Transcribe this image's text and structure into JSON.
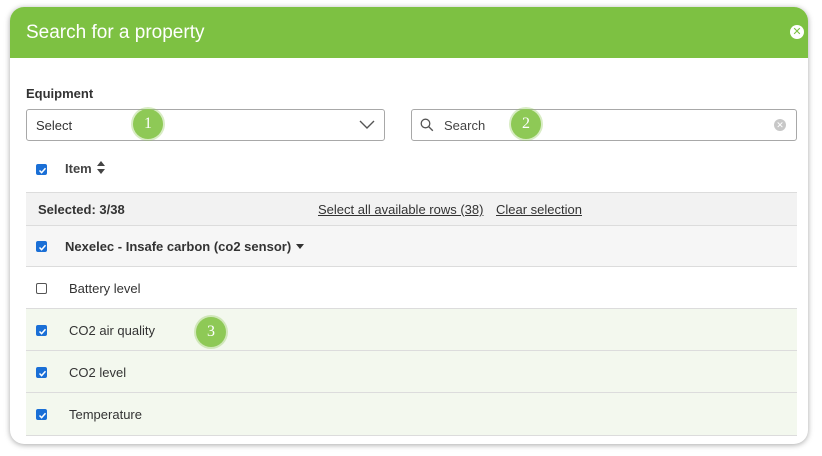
{
  "modal": {
    "title": "Search for a property",
    "close_icon": "close-icon"
  },
  "filters": {
    "equipment_label": "Equipment",
    "equipment_select_value": "Select",
    "search_placeholder": "Search"
  },
  "markers": [
    "1",
    "2",
    "3"
  ],
  "table": {
    "header_item": "Item",
    "selected_text": "Selected: 3/38",
    "select_all_link": "Select all available rows (38)",
    "clear_selection_link": "Clear selection",
    "group": {
      "label": "Nexelec - Insafe carbon (co2 sensor)",
      "checked": true
    },
    "rows": [
      {
        "label": "Battery level",
        "checked": false
      },
      {
        "label": "CO2 air quality",
        "checked": true
      },
      {
        "label": "CO2 level",
        "checked": true
      },
      {
        "label": "Temperature",
        "checked": true
      }
    ]
  },
  "colors": {
    "header_green": "#7dc142",
    "marker_green": "#8ec956",
    "checkbox_blue": "#1a6fd6",
    "selected_row_tint": "#f3f8ee"
  }
}
